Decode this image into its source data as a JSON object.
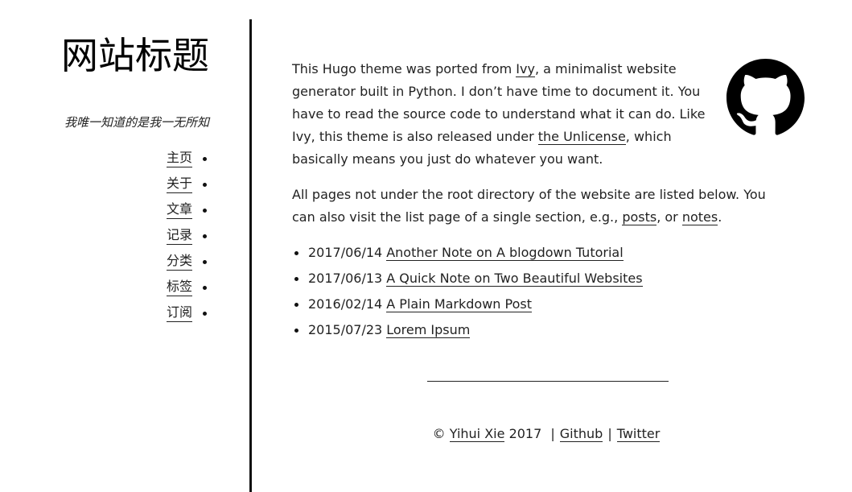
{
  "sidebar": {
    "title": "网站标题",
    "subtitle": "我唯一知道的是我一无所知",
    "menu": [
      {
        "label": "主页"
      },
      {
        "label": "关于"
      },
      {
        "label": "文章"
      },
      {
        "label": "记录"
      },
      {
        "label": "分类"
      },
      {
        "label": "标签"
      },
      {
        "label": "订阅"
      }
    ]
  },
  "main": {
    "intro": {
      "t1": "This Hugo theme was ported from ",
      "link_ivy": "Ivy",
      "t2": ", a minimalist website generator built in Python. I don’t have time to document it. You have to read the source code to understand what it can do. Like Ivy, this theme is also released under ",
      "link_unlicense": "the Unlicense",
      "t3": ", which basically means you just do whatever you want."
    },
    "listing": {
      "t1": "All pages not under the root directory of the website are listed below. You can also visit the list page of a single section, e.g., ",
      "link_posts": "posts",
      "t2": ", or ",
      "link_notes": "notes",
      "t3": "."
    },
    "posts": [
      {
        "date": "2017/06/14",
        "title": "Another Note on A blogdown Tutorial"
      },
      {
        "date": "2017/06/13",
        "title": "A Quick Note on Two Beautiful Websites"
      },
      {
        "date": "2016/02/14",
        "title": "A Plain Markdown Post"
      },
      {
        "date": "2015/07/23",
        "title": "Lorem Ipsum"
      }
    ]
  },
  "footer": {
    "copyright_symbol": "©",
    "author": "Yihui Xie",
    "year": "2017",
    "separator": "|",
    "github": "Github",
    "twitter": "Twitter"
  },
  "icons": {
    "github_logo": "github-icon"
  }
}
